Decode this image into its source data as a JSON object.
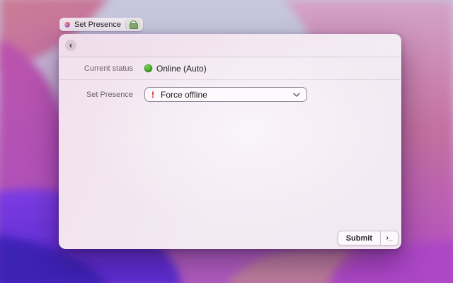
{
  "browser_tab": {
    "title": "Set Presence"
  },
  "icons": {
    "back_chevron": "‹",
    "alert": "!",
    "terminal_prompt": "›_"
  },
  "colors": {
    "status_online_green": "#3fa31f",
    "alert_red": "#d21f1f",
    "wallpaper_magenta": "#b752ae",
    "wallpaper_purple": "#5a2bd0",
    "wallpaper_lavender": "#c6c7de"
  },
  "panel": {
    "rows": {
      "current_status": {
        "label": "Current status",
        "value": "Online (Auto)"
      },
      "set_presence": {
        "label": "Set Presence",
        "selected_option": "Force offline"
      }
    },
    "footer": {
      "submit_label": "Submit"
    }
  }
}
